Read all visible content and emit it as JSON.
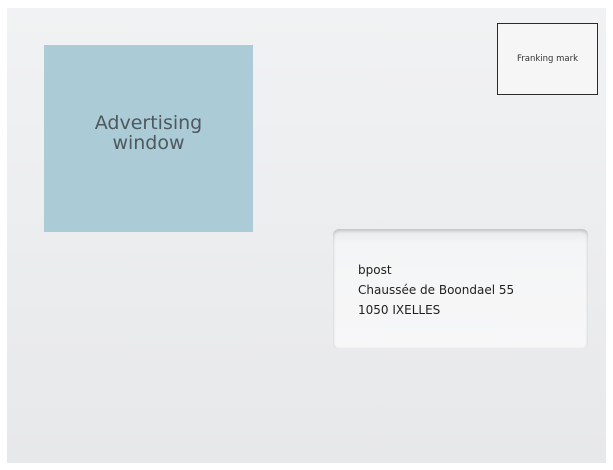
{
  "advertising_window": {
    "label": "Advertising\nwindow"
  },
  "franking_mark": {
    "label": "Franking mark"
  },
  "address": {
    "lines": [
      "bpost",
      "Chaussée de Boondael 55",
      "1050 IXELLES"
    ]
  },
  "colors": {
    "envelope": "#eceded",
    "advertising_window": "#abcbd7",
    "franking_border": "#2b2b2b"
  }
}
